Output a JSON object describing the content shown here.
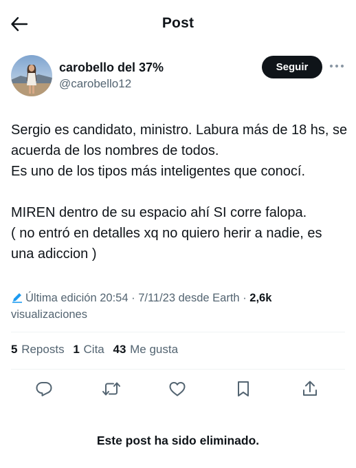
{
  "header": {
    "title": "Post",
    "back_icon": "arrow-left-icon"
  },
  "author": {
    "name": "carobello del 37%",
    "handle": "@carobello12",
    "follow_label": "Seguir",
    "more_icon": "more-horizontal-icon"
  },
  "post": {
    "text": "Sergio es candidato, ministro. Labura más de 18 hs, se acuerda de los nombres de todos.\nEs uno de los tipos más inteligentes que conocí.\n\nMIREN dentro de su espacio ahí SI corre falopa.\n( no entró en detalles xq no quiero herir a nadie, es una adiccion )"
  },
  "meta": {
    "edited_label": "Última edición",
    "time": "20:54",
    "separator": "·",
    "date": "7/11/23",
    "source": "desde Earth",
    "views_count": "2,6k",
    "views_label": "visualizaciones",
    "edit_icon": "pencil-icon",
    "edit_icon_color": "#1d9bf0"
  },
  "stats": {
    "reposts_count": "5",
    "reposts_label": "Reposts",
    "quotes_count": "1",
    "quotes_label": "Cita",
    "likes_count": "43",
    "likes_label": "Me gusta"
  },
  "actions": {
    "reply_icon": "reply-icon",
    "repost_icon": "repost-icon",
    "like_icon": "heart-icon",
    "bookmark_icon": "bookmark-icon",
    "share_icon": "share-icon"
  },
  "footer": {
    "deleted_message": "Este post ha sido eliminado."
  },
  "colors": {
    "text": "#0f1419",
    "secondary": "#536471",
    "divider": "#eff3f4",
    "button_bg": "#0f1419",
    "button_text": "#ffffff"
  }
}
